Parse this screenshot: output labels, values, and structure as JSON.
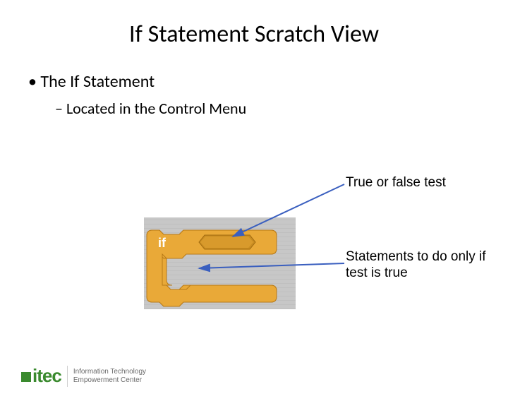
{
  "title": "If Statement Scratch View",
  "bullets": {
    "main": "The If Statement",
    "sub": "Located in the Control Menu"
  },
  "block": {
    "keyword": "if"
  },
  "annotations": {
    "condition": "True or false test",
    "body": "Statements to do only if test is true"
  },
  "logo": {
    "mark": "itec",
    "line1": "Information Technology",
    "line2": "Empowerment Center"
  }
}
